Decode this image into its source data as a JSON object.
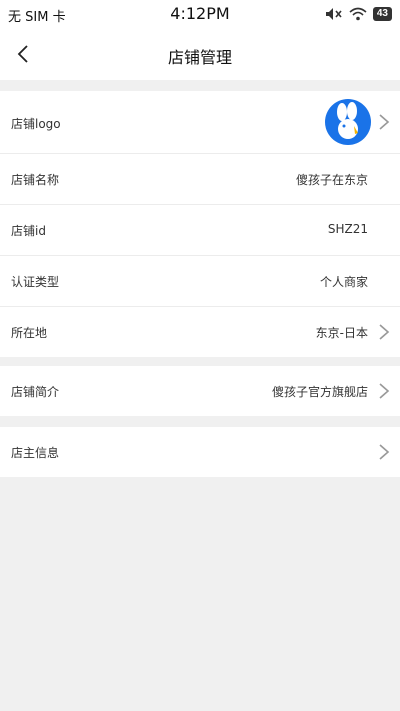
{
  "status_bar": {
    "carrier": "无 SIM 卡",
    "time": "4:12PM",
    "battery": "43",
    "icons": [
      "mute-icon",
      "wifi-icon",
      "battery-icon"
    ]
  },
  "nav": {
    "title": "店铺管理",
    "back_icon": "chevron-left-icon"
  },
  "groups": [
    {
      "rows": [
        {
          "label": "店铺logo",
          "value": "",
          "type": "logo",
          "arrow": true
        },
        {
          "label": "店铺名称",
          "value": "傻孩子在东京",
          "arrow": false
        },
        {
          "label": "店铺id",
          "value": "SHZ21",
          "arrow": false
        },
        {
          "label": "认证类型",
          "value": "个人商家",
          "arrow": false
        },
        {
          "label": "所在地",
          "value": "东京-日本",
          "arrow": true
        }
      ]
    },
    {
      "rows": [
        {
          "label": "店铺简介",
          "value": "傻孩子官方旗舰店",
          "arrow": true
        }
      ]
    },
    {
      "rows": [
        {
          "label": "店主信息",
          "value": "",
          "arrow": true
        }
      ]
    }
  ],
  "colors": {
    "page_bg": "#f0f0f0",
    "logo_bg": "#1a73e8",
    "chevron": "#999999"
  }
}
